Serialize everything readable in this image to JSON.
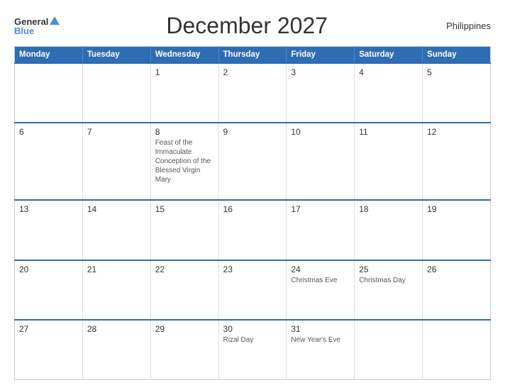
{
  "header": {
    "logo_general": "General",
    "logo_blue": "Blue",
    "title": "December 2027",
    "country": "Philippines"
  },
  "weekdays": [
    "Monday",
    "Tuesday",
    "Wednesday",
    "Thursday",
    "Friday",
    "Saturday",
    "Sunday"
  ],
  "weeks": [
    [
      {
        "day": "",
        "event": ""
      },
      {
        "day": "",
        "event": ""
      },
      {
        "day": "1",
        "event": ""
      },
      {
        "day": "2",
        "event": ""
      },
      {
        "day": "3",
        "event": ""
      },
      {
        "day": "4",
        "event": ""
      },
      {
        "day": "5",
        "event": ""
      }
    ],
    [
      {
        "day": "6",
        "event": ""
      },
      {
        "day": "7",
        "event": ""
      },
      {
        "day": "8",
        "event": "Feast of the Immaculate Conception of the Blessed Virgin Mary"
      },
      {
        "day": "9",
        "event": ""
      },
      {
        "day": "10",
        "event": ""
      },
      {
        "day": "11",
        "event": ""
      },
      {
        "day": "12",
        "event": ""
      }
    ],
    [
      {
        "day": "13",
        "event": ""
      },
      {
        "day": "14",
        "event": ""
      },
      {
        "day": "15",
        "event": ""
      },
      {
        "day": "16",
        "event": ""
      },
      {
        "day": "17",
        "event": ""
      },
      {
        "day": "18",
        "event": ""
      },
      {
        "day": "19",
        "event": ""
      }
    ],
    [
      {
        "day": "20",
        "event": ""
      },
      {
        "day": "21",
        "event": ""
      },
      {
        "day": "22",
        "event": ""
      },
      {
        "day": "23",
        "event": ""
      },
      {
        "day": "24",
        "event": "Christmas Eve"
      },
      {
        "day": "25",
        "event": "Christmas Day"
      },
      {
        "day": "26",
        "event": ""
      }
    ],
    [
      {
        "day": "27",
        "event": ""
      },
      {
        "day": "28",
        "event": ""
      },
      {
        "day": "29",
        "event": ""
      },
      {
        "day": "30",
        "event": "Rizal Day"
      },
      {
        "day": "31",
        "event": "New Year's Eve"
      },
      {
        "day": "",
        "event": ""
      },
      {
        "day": "",
        "event": ""
      }
    ]
  ]
}
